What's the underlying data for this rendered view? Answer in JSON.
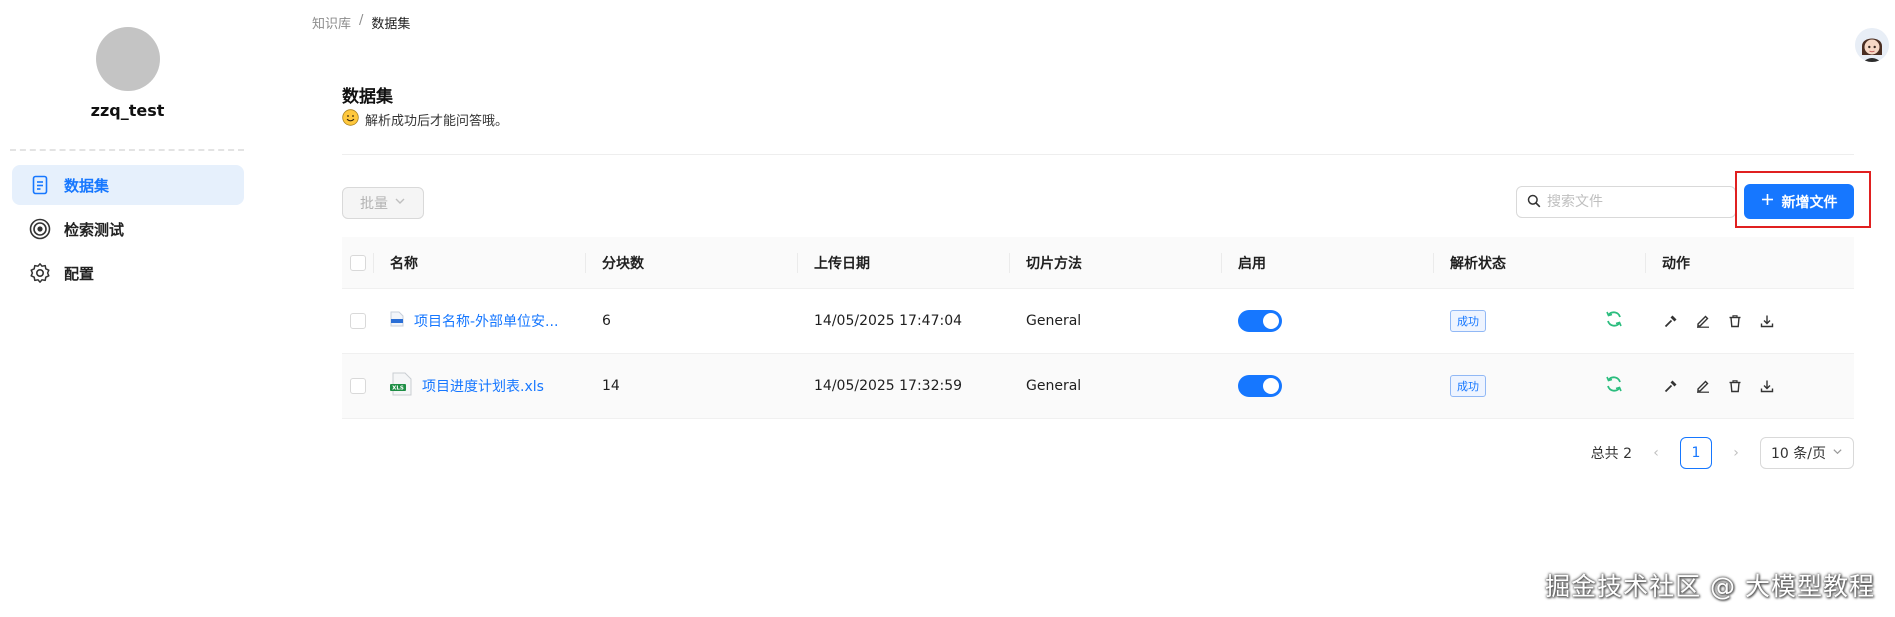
{
  "sidebar": {
    "username": "zzq_test",
    "items": [
      {
        "label": "数据集",
        "icon": "document-icon",
        "active": true
      },
      {
        "label": "检索测试",
        "icon": "target-icon",
        "active": false
      },
      {
        "label": "配置",
        "icon": "gear-icon",
        "active": false
      }
    ]
  },
  "breadcrumb": {
    "root": "知识库",
    "separator": "/",
    "current": "数据集"
  },
  "header": {
    "title": "数据集",
    "subtitle": "解析成功后才能问答哦。"
  },
  "toolbar": {
    "batch_label": "批量",
    "search_placeholder": "搜索文件",
    "add_label": "新增文件"
  },
  "table": {
    "columns": [
      "名称",
      "分块数",
      "上传日期",
      "切片方法",
      "启用",
      "解析状态",
      "动作"
    ],
    "rows": [
      {
        "name": "项目名称-外部单位安...",
        "file_type": "doc",
        "chunks": "6",
        "date": "14/05/2025 17:47:04",
        "method": "General",
        "enabled": true,
        "status": "成功"
      },
      {
        "name": "项目进度计划表.xls",
        "file_type": "xls",
        "chunks": "14",
        "date": "14/05/2025 17:32:59",
        "method": "General",
        "enabled": true,
        "status": "成功"
      }
    ]
  },
  "pagination": {
    "total_label": "总共 2",
    "current_page": "1",
    "page_size": "10 条/页"
  },
  "watermark": "掘金技术社区 @ 大模型教程",
  "colors": {
    "primary": "#1677ff",
    "success_icon": "#2bbd7e",
    "highlight": "#e02020"
  }
}
